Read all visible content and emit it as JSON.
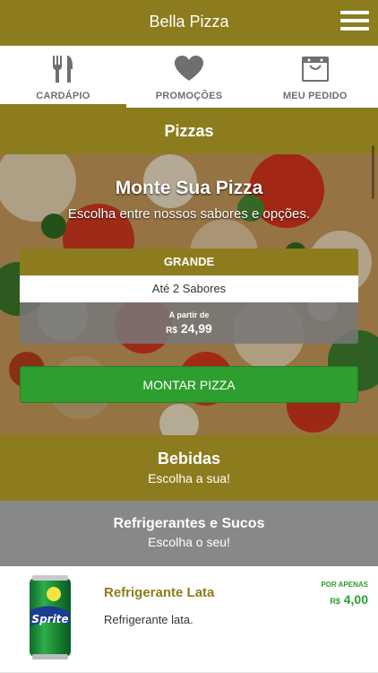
{
  "header": {
    "title": "Bella Pizza",
    "menu_icon": "hamburger-menu-icon"
  },
  "tabs": [
    {
      "label": "CARDÁPIO",
      "icon": "fork-knife-icon",
      "active": true
    },
    {
      "label": "PROMOÇÕES",
      "icon": "heart-icon",
      "active": false
    },
    {
      "label": "MEU PEDIDO",
      "icon": "shopping-bag-icon",
      "active": false
    }
  ],
  "pizzas": {
    "section_title": "Pizzas",
    "hero_title": "Monte Sua Pizza",
    "hero_subtitle": "Escolha entre nossos sabores e opções.",
    "size": {
      "name": "GRANDE",
      "flavors": "Até 2 Sabores",
      "from_label": "A partir de",
      "currency": "R$",
      "price": "24,99"
    },
    "build_button": "MONTAR PIZZA"
  },
  "bebidas": {
    "title": "Bebidas",
    "subtitle": "Escolha a sua!",
    "subcategory": {
      "title": "Refrigerantes e Sucos",
      "subtitle": "Escolha o seu!"
    },
    "product": {
      "name": "Refrigerante Lata",
      "description": "Refrigerante lata.",
      "price_label": "POR APENAS",
      "currency": "R$",
      "price": "4,00",
      "image_text": "Sprite"
    }
  },
  "colors": {
    "brand": "#8c7c1d",
    "green": "#2e9e2e",
    "gray": "#888888"
  }
}
